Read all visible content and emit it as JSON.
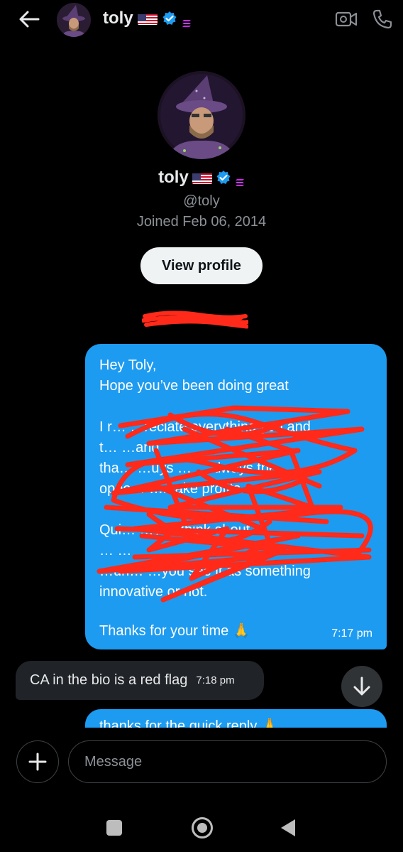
{
  "header": {
    "name": "toly",
    "avatar_icon": "wizard-avatar",
    "back_icon": "arrow-left-icon",
    "video_icon": "video-call-icon",
    "phone_icon": "phone-icon"
  },
  "profile": {
    "name": "toly",
    "handle": "@toly",
    "joined": "Joined Feb 06, 2014",
    "view_profile_label": "View profile"
  },
  "messages": [
    {
      "direction": "outgoing",
      "lines_visible": [
        "Hey Toly,",
        "Hope you’ve been doing great"
      ],
      "redacted_lines": [
        "I r… …reciate everything you and",
        "t… …and",
        "tha… …uys … …always the",
        "oppo… …make profits.",
        "",
        "Qui… …you think about",
        "… …",
        "…un… …you see it as something",
        "innovative or not."
      ],
      "closing": "Thanks for your time 🙏",
      "time": "7:17 pm"
    },
    {
      "direction": "incoming",
      "text": "CA in the bio is a red flag",
      "time": "7:18 pm"
    },
    {
      "direction": "outgoing",
      "text": "thanks for the quick reply 🙏",
      "partial": true
    }
  ],
  "composer": {
    "placeholder": "Message",
    "add_icon": "plus-icon"
  },
  "colors": {
    "background": "#000000",
    "outgoing_bubble": "#1d9bf0",
    "incoming_bubble": "#202327",
    "verified": "#1d9bf0",
    "redaction": "#ff2a1a"
  }
}
